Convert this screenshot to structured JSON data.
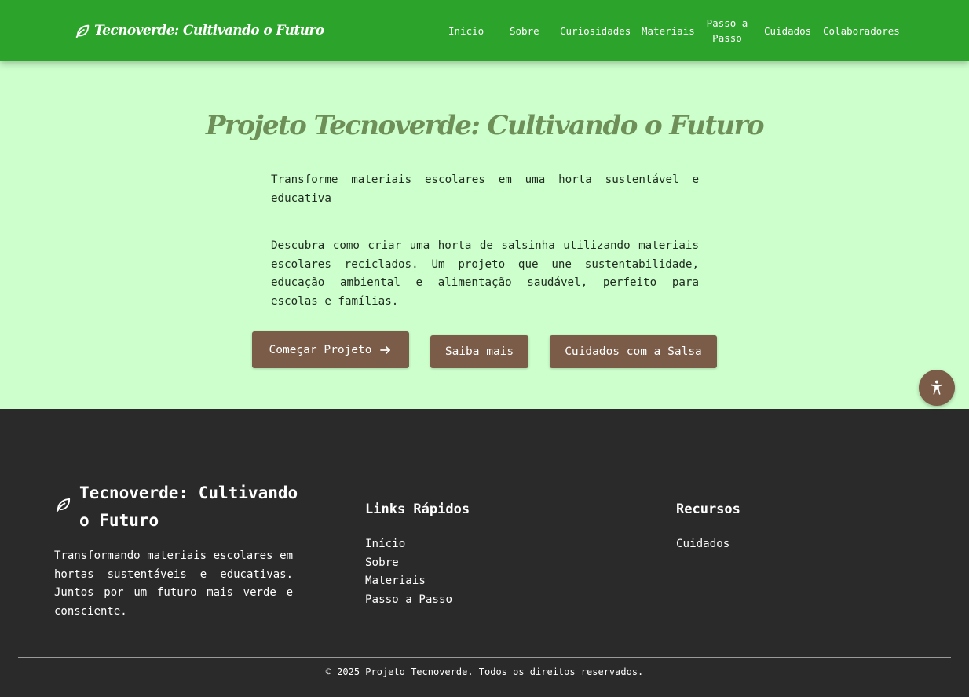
{
  "header": {
    "brand": "Tecnoverde: Cultivando o Futuro",
    "brand_icon": "leaf-icon",
    "nav": [
      {
        "label": "Início"
      },
      {
        "label": "Sobre"
      },
      {
        "label": "Curiosidades"
      },
      {
        "label": "Materiais"
      },
      {
        "label": "Passo a Passo"
      },
      {
        "label": "Cuidados"
      },
      {
        "label": "Colaboradores"
      }
    ]
  },
  "hero": {
    "title": "Projeto Tecnoverde: Cultivando o Futuro",
    "subtitle": "Transforme materiais escolares em uma horta sustentável e educativa",
    "description": "Descubra como criar uma horta de salsinha utilizando materiais escolares reciclados. Um projeto que une sustentabilidade, educação ambiental e alimentação saudável, perfeito para escolas e famílias.",
    "buttons": {
      "start": "Começar Projeto",
      "start_icon": "arrow-right-icon",
      "more": "Saiba mais",
      "care": "Cuidados com a Salsa"
    }
  },
  "accessibility_button": {
    "icon": "accessibility-icon"
  },
  "footer": {
    "brand": "Tecnoverde: Cultivando o Futuro",
    "description": "Transformando materiais escolares em hortas sustentáveis e educativas. Juntos por um futuro mais verde e consciente.",
    "quick_links_title": "Links Rápidos",
    "quick_links": [
      "Início",
      "Sobre",
      "Materiais",
      "Passo a Passo"
    ],
    "resources_title": "Recursos",
    "resources": [
      "Cuidados"
    ],
    "copyright": "© 2025 Projeto Tecnoverde. Todos os direitos reservados."
  },
  "colors": {
    "header_bg": "#2ca42c",
    "hero_bg": "#ccffcc",
    "title": "#6e8f57",
    "button_bg": "#7a5c48",
    "footer_bg": "#2a2a2a"
  }
}
